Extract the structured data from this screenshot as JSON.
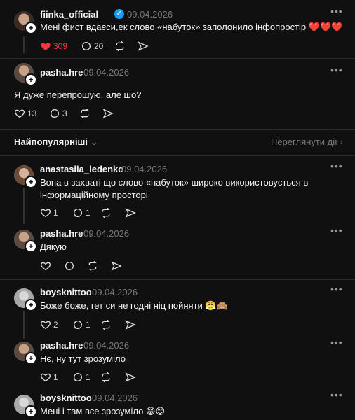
{
  "posts": [
    {
      "username": "fiinka_official",
      "verified": true,
      "date": "09.04.2026",
      "text": "Мені фист вдаєси,ек слово «набуток» заполонило інфопростір",
      "hearts": "❤️❤️❤️",
      "likes": "309",
      "replies": "20"
    },
    {
      "username": "pasha.hre",
      "date": "09.04.2026",
      "text": "Я дуже перепрошую, але шо?",
      "likes": "13",
      "replies": "3"
    }
  ],
  "sort": {
    "label": "Найпопулярніші",
    "view_activity": "Переглянути дії"
  },
  "replies": [
    {
      "username": "anastasiia_ledenko",
      "date": "09.04.2026",
      "text1": "Вона в захваті що слово «набуток» широко використовується в",
      "text2": "інформаційному просторі",
      "likes": "1",
      "replies": "1"
    },
    {
      "username": "pasha.hre",
      "date": "09.04.2026",
      "text": "Дякую",
      "likes": "",
      "replies": ""
    },
    {
      "username": "boysknittoo",
      "date": "09.04.2026",
      "text": "Боже боже, гет си не годні ніц пойняти 😤🙈",
      "likes": "2",
      "replies": "1"
    },
    {
      "username": "pasha.hre",
      "date": "09.04.2026",
      "text": "Нє, ну тут зрозуміло",
      "likes": "1",
      "replies": "1"
    },
    {
      "username": "boysknittoo",
      "date": "09.04.2026",
      "text": "Мені і там все зрозуміло 😁😊"
    }
  ],
  "icons": {
    "heart": "heart-icon",
    "comment": "comment-icon",
    "repost": "repost-icon",
    "share": "share-icon",
    "more": "more-icon",
    "chevron": "chevron-icon"
  }
}
